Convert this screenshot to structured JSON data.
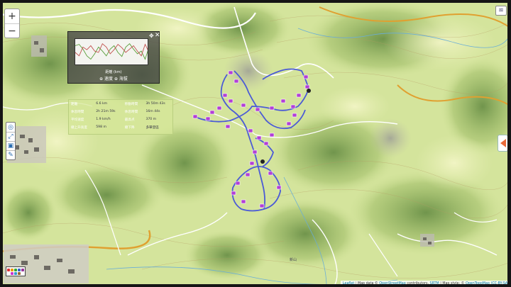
{
  "map": {
    "zoom_in": "+",
    "zoom_out": "−",
    "layer_icon": "layers-icon",
    "side_toggle_icon": "triangle-left-icon",
    "accent_route": "#5566dd",
    "waypoint_color": "#b23fd6",
    "place_label": "新山"
  },
  "elevation_panel": {
    "xlabel": "距離 (km)",
    "legend": "⊕ 速度 ⊕ 海拔",
    "move_icon": "move-icon",
    "close_icon": "close-icon",
    "series": [
      {
        "name": "",
        "color": "#5a9e3a",
        "values": [
          60,
          62,
          55,
          45,
          40,
          48,
          58,
          52,
          45,
          55,
          60,
          50,
          44,
          58,
          63,
          55,
          48,
          52,
          40,
          58
        ]
      },
      {
        "name": "",
        "color": "#c0504d",
        "values": [
          50,
          45,
          58,
          54,
          60,
          52,
          50,
          63,
          58,
          48,
          54,
          62,
          57,
          50,
          55,
          60,
          52,
          45,
          62,
          50
        ]
      }
    ]
  },
  "stats": {
    "rows": [
      [
        "距離",
        "6.6 km",
        "移動時間",
        "3h 50m 43s"
      ],
      [
        "休息時間",
        "2h 21m 59s",
        "休息時間",
        "16m 44s"
      ],
      [
        "平均速度",
        "1.9 km/h",
        "最高点",
        "370 m"
      ],
      [
        "總上升高度",
        "598 m",
        "總下降",
        "多單登區"
      ]
    ]
  },
  "attribution": {
    "leaflet": "Leaflet",
    "map_data": "Map data ©",
    "osm": "OpenStreetMap",
    "contributors": "contributors,",
    "srtm": "SRTM",
    "map_style": "| Map style: ©",
    "otm": "OpenTopoMap",
    "license": "(CC-BY-SA)"
  }
}
